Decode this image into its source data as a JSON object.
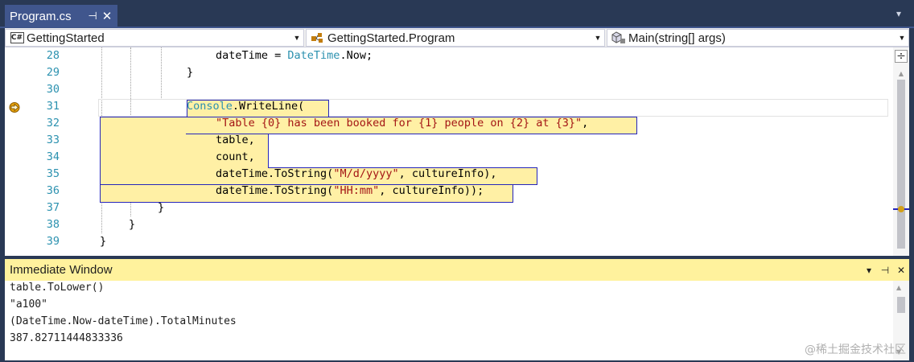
{
  "tab": {
    "title": "Program.cs",
    "pin_icon": "pin-icon",
    "close_icon": "close-icon"
  },
  "navbar": {
    "project": {
      "label": "GettingStarted",
      "icon": "csharp-project-icon",
      "icon_text": "C#"
    },
    "type": {
      "label": "GettingStarted.Program",
      "icon": "class-icon"
    },
    "member": {
      "label": "Main(string[] args)",
      "icon": "method-icon"
    }
  },
  "editor": {
    "lines": [
      {
        "num": "28",
        "parts": [
          {
            "t": "dateTime = ",
            "c": ""
          },
          {
            "t": "DateTime",
            "c": "type"
          },
          {
            "t": ".Now;",
            "c": ""
          }
        ]
      },
      {
        "num": "29",
        "parts": [
          {
            "t": "}",
            "c": ""
          }
        ]
      },
      {
        "num": "30",
        "parts": []
      },
      {
        "num": "31",
        "parts": [
          {
            "t": "Console",
            "c": "type"
          },
          {
            "t": ".WriteLine(",
            "c": ""
          }
        ]
      },
      {
        "num": "32",
        "parts": [
          {
            "t": "\"Table {0} has been booked for {1} people on {2} at {3}\"",
            "c": "str"
          },
          {
            "t": ",",
            "c": ""
          }
        ]
      },
      {
        "num": "33",
        "parts": [
          {
            "t": "table,",
            "c": ""
          }
        ]
      },
      {
        "num": "34",
        "parts": [
          {
            "t": "count,",
            "c": ""
          }
        ]
      },
      {
        "num": "35",
        "parts": [
          {
            "t": "dateTime.ToString(",
            "c": ""
          },
          {
            "t": "\"M/d/yyyy\"",
            "c": "str"
          },
          {
            "t": ", cultureInfo),",
            "c": ""
          }
        ]
      },
      {
        "num": "36",
        "parts": [
          {
            "t": "dateTime.ToString(",
            "c": ""
          },
          {
            "t": "\"HH:mm\"",
            "c": "str"
          },
          {
            "t": ", cultureInfo));",
            "c": ""
          }
        ]
      },
      {
        "num": "37",
        "parts": [
          {
            "t": "}",
            "c": ""
          }
        ]
      },
      {
        "num": "38",
        "parts": [
          {
            "t": "}",
            "c": ""
          }
        ]
      },
      {
        "num": "39",
        "parts": [
          {
            "t": "}",
            "c": ""
          }
        ]
      }
    ],
    "current_statement_line": "31",
    "colors": {
      "highlight": "#fff0a5",
      "highlight_border": "#2525bb",
      "line_number": "#2b91af",
      "type": "#2b91af",
      "string": "#a31515"
    }
  },
  "immediate": {
    "title": "Immediate Window",
    "lines": [
      "table.ToLower()",
      "\"a100\"",
      "(DateTime.Now-dateTime).TotalMinutes",
      "387.82711444833336"
    ],
    "buttons": {
      "dropdown": "▾",
      "pin": "pin-icon",
      "close": "close-icon"
    }
  },
  "watermark": "@稀土掘金技术社区"
}
